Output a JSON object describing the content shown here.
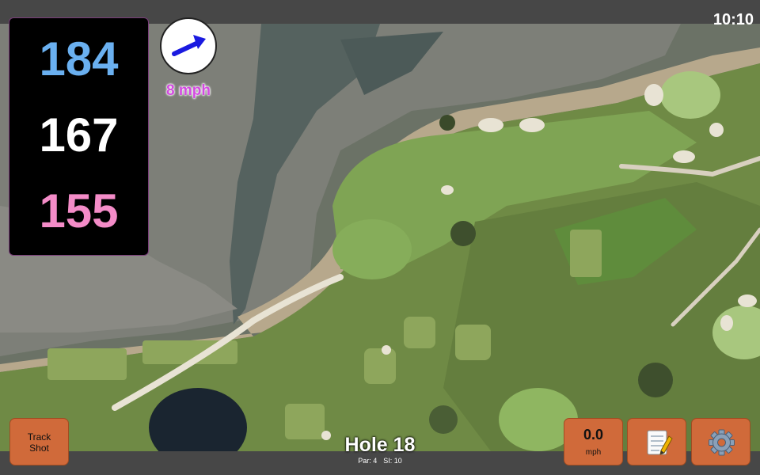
{
  "status": {
    "time": "10:10"
  },
  "distances": {
    "back": "184",
    "middle": "167",
    "front": "155"
  },
  "wind": {
    "speed": "8 mph",
    "direction": "east-north-east"
  },
  "buttons": {
    "track_shot": "Track\nShot",
    "speed_value": "0.0",
    "speed_unit": "mph"
  },
  "hole": {
    "title": "Hole 18",
    "par": "Par: 4",
    "si": "SI: 10"
  },
  "icons": {
    "wind": "arrow-icon",
    "notes": "notepad-icon",
    "settings": "gear-icon"
  },
  "colors": {
    "back": "#6ab0f0",
    "middle": "#ffffff",
    "front": "#f48cc8",
    "wind_text": "#d24be0",
    "button": "#d06a3a",
    "arrow": "#1a1ae0"
  }
}
